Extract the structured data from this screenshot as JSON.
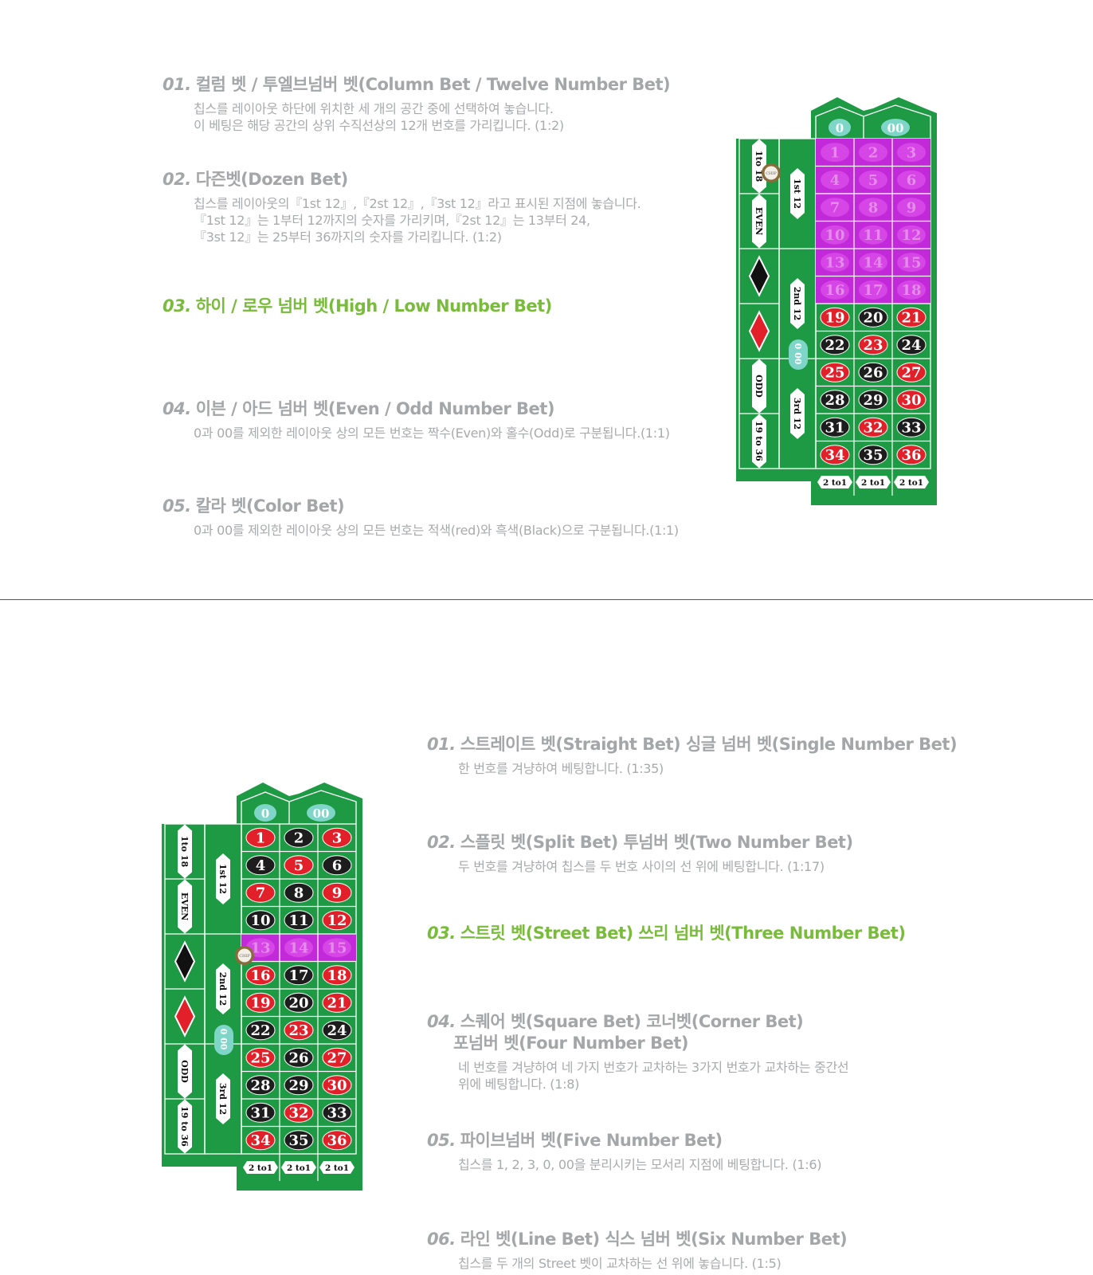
{
  "section1": {
    "items": [
      {
        "num": "01.",
        "title": "컬럼 벳 / 투엘브넘버 벳(Column Bet / Twelve Number Bet)",
        "desc": [
          "칩스를 레이아웃 하단에 위치한 세 개의 공간 중에 선택하여 놓습니다.",
          "이 베팅은 해당 공간의 상위 수직선상의 12개 번호를 가리킵니다. (1:2)"
        ]
      },
      {
        "num": "02.",
        "title": "다즌벳(Dozen Bet)",
        "desc": [
          "칩스를 레이아웃의『1st 12』,『2st 12』,『3st 12』라고 표시된 지점에 놓습니다.",
          "『1st 12』는 1부터 12까지의 숫자를 가리키며,『2st 12』는 13부터 24,",
          "『3st 12』는 25부터 36까지의 숫자를 가리킵니다. (1:2)"
        ]
      },
      {
        "num": "03.",
        "title": "하이 / 로우 넘버 벳(High / Low Number Bet)",
        "desc": []
      },
      {
        "num": "04.",
        "title": "이븐 / 아드 넘버 벳(Even / Odd Number Bet)",
        "desc": [
          "0과 00를 제외한 레이아웃 상의 모든 번호는 짝수(Even)와 홀수(Odd)로 구분됩니다.(1:1)"
        ]
      },
      {
        "num": "05.",
        "title": "칼라 벳(Color Bet)",
        "desc": [
          "0과 00를 제외한 레이아웃 상의 모든 번호는 적색(red)와 흑색(Black)으로 구분됩니다.(1:1)"
        ]
      }
    ]
  },
  "section2": {
    "items": [
      {
        "num": "01.",
        "title": "스트레이트 벳(Straight Bet) 싱글 넘버 벳(Single Number Bet)",
        "desc": [
          "한 번호를 겨냥하여 베팅합니다. (1:35)"
        ]
      },
      {
        "num": "02.",
        "title": "스플릿 벳(Split Bet) 투넘버 벳(Two Number Bet)",
        "desc": [
          "두 번호를 겨냥하여 칩스를 두 번호 사이의 선 위에 베팅합니다. (1:17)"
        ]
      },
      {
        "num": "03.",
        "title": "스트릿 벳(Street Bet) 쓰리 넘버 벳(Three Number Bet)",
        "desc": []
      },
      {
        "num": "04.",
        "title": "스퀘어 벳(Square Bet) 코너벳(Corner Bet)",
        "title2": "포넘버 벳(Four Number Bet)",
        "desc": [
          "네 번호를 겨냥하여 네 가지 번호가 교차하는 3가지 번호가 교차하는 중간선",
          "위에 베팅합니다. (1:8)"
        ]
      },
      {
        "num": "05.",
        "title": "파이브넘버 벳(Five Number Bet)",
        "desc": [
          "칩스를 1, 2, 3, 0, 00을 분리시키는 모서리 지점에 베팅합니다. (1:6)"
        ]
      },
      {
        "num": "06.",
        "title": "라인 벳(Line Bet) 식스 넘버 벳(Six Number Bet)",
        "desc": [
          "칩스를 두 개의 Street 벳이 교차하는 선 위에 놓습니다. (1:5)"
        ]
      }
    ]
  },
  "table": {
    "zeros": [
      "0",
      "00"
    ],
    "outside_labels": [
      "1to 18",
      "EVEN",
      "ODD",
      "19 to 36"
    ],
    "dozen_labels": [
      "1st 12",
      "2nd 12",
      "3rd 12"
    ],
    "column_label": "2 to1",
    "chip_label": "CHIP",
    "numbers": [
      1,
      2,
      3,
      4,
      5,
      6,
      7,
      8,
      9,
      10,
      11,
      12,
      13,
      14,
      15,
      16,
      17,
      18,
      19,
      20,
      21,
      22,
      23,
      24,
      25,
      26,
      27,
      28,
      29,
      30,
      31,
      32,
      33,
      34,
      35,
      36
    ],
    "red_numbers": [
      1,
      3,
      5,
      7,
      9,
      12,
      14,
      16,
      18,
      19,
      21,
      23,
      25,
      27,
      30,
      32,
      34,
      36
    ],
    "table1_highlight_rows": [
      0,
      1,
      2,
      3,
      4,
      5
    ],
    "table2_highlight_rows": [
      4
    ]
  },
  "colors": {
    "felt": "#1e9a45",
    "highlight": "#c22ad9",
    "red": "#e2202a",
    "black": "#1d1d1d",
    "active_title": "#79bb3b",
    "inactive_title": "#a4a6a8",
    "zero": "#7fd6c8"
  }
}
